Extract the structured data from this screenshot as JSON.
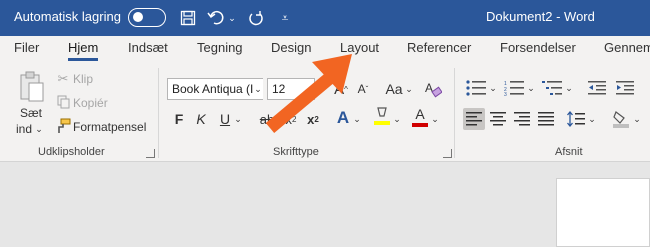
{
  "title_bar": {
    "autosave_label": "Automatisk lagring",
    "document_title": "Dokument2  -  Word"
  },
  "tabs": [
    {
      "label": "Filer"
    },
    {
      "label": "Hjem"
    },
    {
      "label": "Indsæt"
    },
    {
      "label": "Tegning"
    },
    {
      "label": "Design"
    },
    {
      "label": "Layout"
    },
    {
      "label": "Referencer"
    },
    {
      "label": "Forsendelser"
    },
    {
      "label": "Gennem"
    }
  ],
  "clipboard": {
    "paste_label": "Sæt",
    "paste_label_2": "ind",
    "cut_label": "Klip",
    "copy_label": "Kopiér",
    "format_painter_label": "Formatpensel",
    "group_label": "Udklipsholder"
  },
  "font": {
    "font_name": "Book Antiqua (I",
    "font_size": "12",
    "grow_label": "A",
    "shrink_label": "A",
    "case_label": "Aa",
    "bold_label": "F",
    "italic_label": "K",
    "underline_label": "U",
    "strike_label": "ab",
    "subscript_label": "x",
    "superscript_label": "x",
    "effects_label": "A",
    "highlight_label": "ab",
    "color_label": "A",
    "group_label": "Skrifttype"
  },
  "paragraph": {
    "group_label": "Afsnit"
  },
  "colors": {
    "title_bar": "#2b579a",
    "arrow": "#f26522",
    "highlight": "#ffff00",
    "font_color": "#d00000",
    "effects": "#2b579a"
  }
}
